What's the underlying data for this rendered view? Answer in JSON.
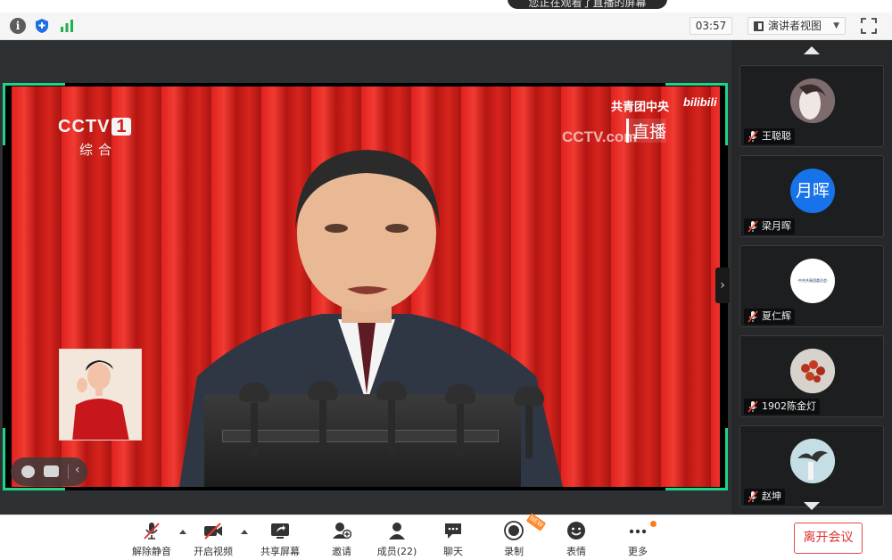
{
  "toast": {
    "text": "您正在观看了直播的屏幕"
  },
  "topbar": {
    "timer": "03:57",
    "view_mode": "演讲者视图"
  },
  "video": {
    "channel_logo": "CCTV",
    "channel_number": "1",
    "channel_sub": "综合",
    "source_label": "共青团中央",
    "platform_label": "bilibili",
    "watermark": "CCTV.com",
    "live_label": "直播"
  },
  "participants": [
    {
      "name": "王聪聪",
      "avatar_type": "photo",
      "avatar_color": "#8f7d7e"
    },
    {
      "name": "梁月晖",
      "avatar_type": "text",
      "avatar_text": "月晖",
      "avatar_color": "#1673ea"
    },
    {
      "name": "夏仁辉",
      "avatar_type": "logo",
      "avatar_text": "·中共共青团委员会·",
      "avatar_color": "#ffffff"
    },
    {
      "name": "1902陈金灯",
      "avatar_type": "photo",
      "avatar_color": "#d7d0ca"
    },
    {
      "name": "赵坤",
      "avatar_type": "photo",
      "avatar_color": "#bfdbe5"
    }
  ],
  "controls": {
    "unmute": "解除静音",
    "start_video": "开启视频",
    "share_screen": "共享屏幕",
    "invite": "邀请",
    "members": "成员(22)",
    "chat": "聊天",
    "record": "录制",
    "reactions": "表情",
    "more": "更多",
    "leave": "离开会议",
    "new_badge": "NEW"
  },
  "colors": {
    "accent_green": "#1fd486",
    "avatar_blue": "#1673ea",
    "leave_red": "#e03030",
    "badge_orange": "#ff8a2a"
  }
}
